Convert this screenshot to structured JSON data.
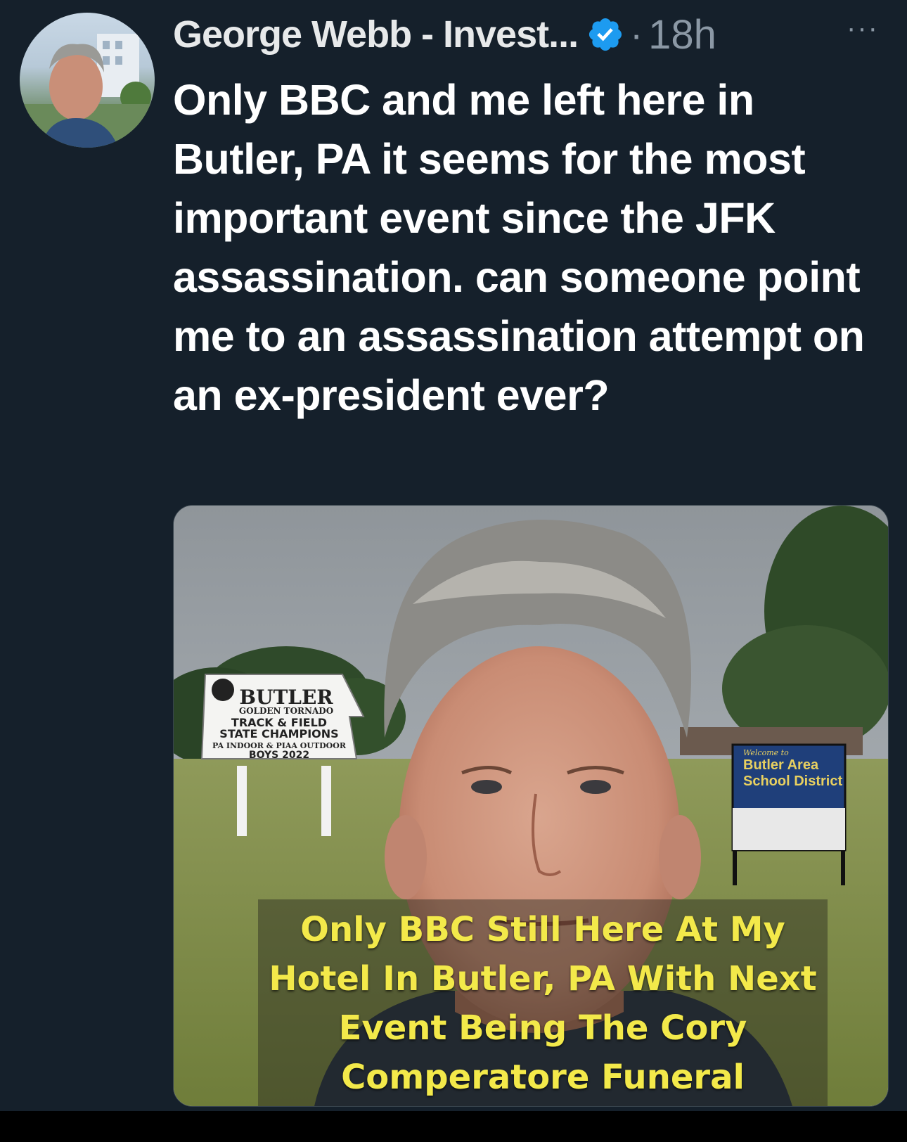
{
  "tweet": {
    "author_name": "George Webb - Invest...",
    "timestamp": "18h",
    "separator": "·",
    "more_label": "···",
    "text": "Only BBC and me left here in Butler, PA it seems for the most important event since the JFK assassination. can someone point me to an assassination attempt on an ex-president ever?",
    "media": {
      "caption": "Only BBC Still Here At My Hotel In Butler, PA With Next Event Being The Cory Comperatore Funeral",
      "sign_left": {
        "title": "BUTLER",
        "subtitle": "GOLDEN TORNADO",
        "line1": "TRACK & FIELD",
        "line2": "STATE CHAMPIONS",
        "line3": "PA INDOOR & PIAA OUTDOOR",
        "line4": "BOYS 2022"
      },
      "sign_right": {
        "welcome": "Welcome to",
        "line1": "Butler Area",
        "line2": "School District"
      }
    }
  },
  "colors": {
    "background": "#15202b",
    "text_primary": "#e7e9ea",
    "text_secondary": "#8b98a5",
    "verified_badge": "#1d9bf0",
    "caption": "#f3e94a"
  },
  "icons": {
    "verified": "verified-badge-icon",
    "more": "more-horizontal-icon"
  }
}
